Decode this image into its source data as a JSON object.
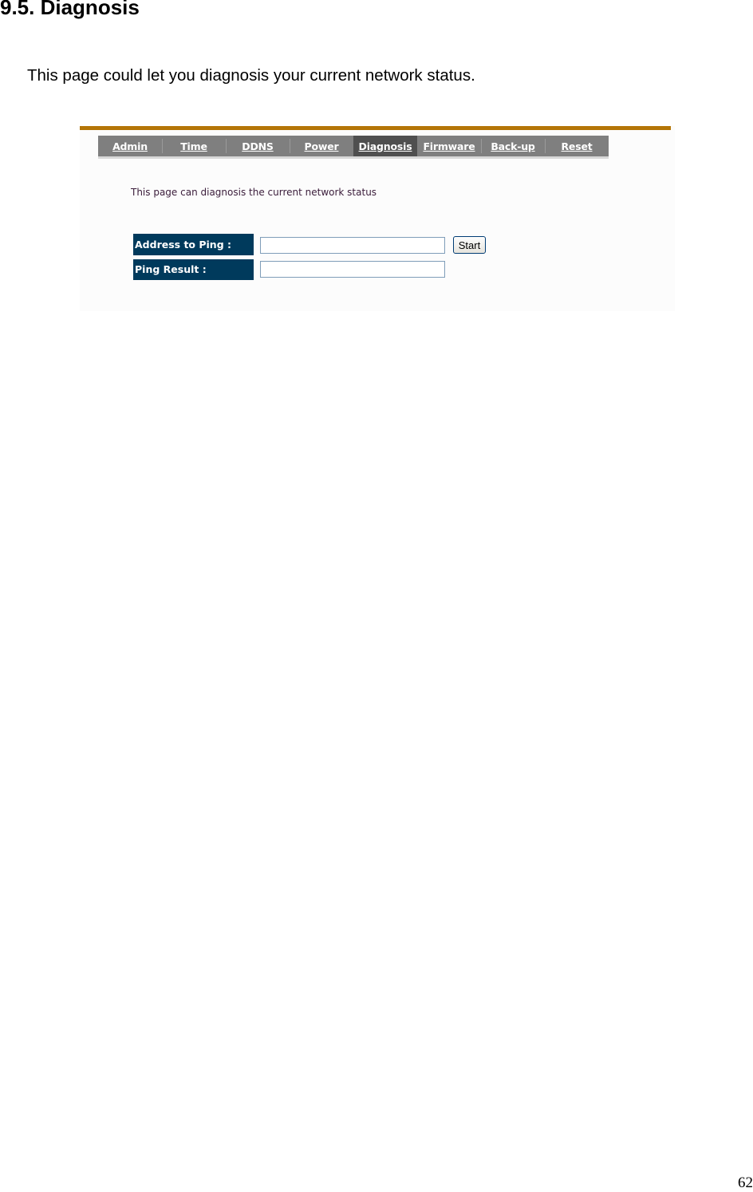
{
  "document": {
    "heading": "9.5. Diagnosis",
    "intro": "This page could let you diagnosis your current network status.",
    "page_number": "62"
  },
  "screenshot": {
    "colors": {
      "accent_bar": "#b47507",
      "nav_background": "#7f7f7f",
      "nav_active": "#4f4f4f",
      "label_background": "#003a5c"
    },
    "nav": {
      "active": "Diagnosis",
      "tabs": [
        {
          "label": "Admin"
        },
        {
          "label": "Time"
        },
        {
          "label": "DDNS"
        },
        {
          "label": "Power"
        },
        {
          "label": "Diagnosis"
        },
        {
          "label": "Firmware"
        },
        {
          "label": "Back-up"
        },
        {
          "label": "Reset"
        }
      ]
    },
    "description": "This page can diagnosis the current network status",
    "form": {
      "address_label": "Address to Ping :",
      "address_value": "",
      "result_label": "Ping Result :",
      "result_value": "",
      "start_button": "Start"
    }
  }
}
